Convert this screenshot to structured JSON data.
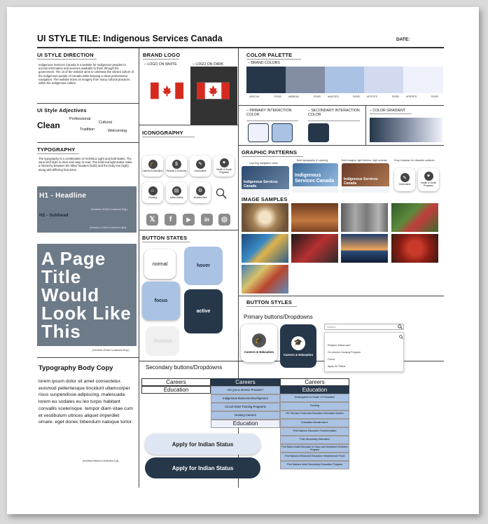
{
  "title": "UI STYLE TILE: Indigenous Services Canada",
  "date_label": "DATE:",
  "ui_style_direction": {
    "heading": "UI STYLE DIRECTION",
    "body": "Indigenous Services Canada is a website for Indigenous peoples to access information and services available to them through the government. The UI of the website aims to celebrate the vibrant culture of the Indigenous people of Canada while keeping a clean professional navigation. The website leans on imagery from many cultural practices within the Indigenous culture."
  },
  "adjectives": {
    "heading": "UI Style Adjectives",
    "clean": "Clean",
    "professional": "Professional",
    "cultural": "Cultural",
    "tradition": "Tradition",
    "welcoming": "Welcoming"
  },
  "typography": {
    "heading": "TYPOGRAPHY",
    "body": "The typography is a combination of Helvetica Light and bold states. The sans serif style is clear and easy to read. The bold and light states make a hierarchy between the titles/ headers (bold) and the body text (light), along with differing font sizes.",
    "h1": "H1 - Headline",
    "h1_note": "(Helvetica 18 Bold Condensed Regl.)",
    "h2": "H2 - Subhead",
    "h2_note": "(Helvetica 14 Bold Condensed Light)",
    "page_title": "A Page Title Would Look Like This",
    "page_title_note": "(Helvetica 40 Bold Condensed Regl.)",
    "body_heading": "Typography Body Copy",
    "body_copy": "lorem ipsum dolor sit amet consectetur. euismod pellentesque tincidunt ullamcorper risus suspendisse adipiscing. malesuada lorem eu sodales eu leo turpis habitant convallis scelerisque. tempor diam vitae cum et vestibulum ultrices aliquet imperdiet ornare. eget donec bibendum natoque tortor.",
    "body_note": "(Helvetica Medium Condensed  11pt)"
  },
  "brand_logo": {
    "heading": "BRAND LOGO",
    "on_white": "– LOGO ON WHITE",
    "on_dark": "– LOGO ON DARK"
  },
  "iconography": {
    "heading": "ICONOGRAPHY",
    "icons": [
      {
        "name": "careers-education",
        "label": "Careers & Education",
        "glyph": "🎓"
      },
      {
        "name": "finance-economy",
        "label": "Finance & Economy",
        "glyph": "$"
      },
      {
        "name": "governance",
        "label": "Governance",
        "glyph": "✎"
      },
      {
        "name": "health-social",
        "label": "Health & Social Programs",
        "glyph": "♥"
      },
      {
        "name": "housing",
        "label": "Housing",
        "glyph": "⌂"
      },
      {
        "name": "indian-status",
        "label": "Indian Status",
        "glyph": "▤"
      },
      {
        "name": "infrastructure",
        "label": "Infrastructure",
        "glyph": "⚙"
      }
    ],
    "social": [
      {
        "name": "x",
        "glyph": "𝕏"
      },
      {
        "name": "facebook",
        "glyph": "f"
      },
      {
        "name": "youtube",
        "glyph": "▶"
      },
      {
        "name": "linkedin",
        "glyph": "in"
      },
      {
        "name": "instagram",
        "glyph": "◎"
      }
    ]
  },
  "button_states": {
    "heading": "BUTTON STATES",
    "normal": "normal",
    "hover": "hover",
    "focus": "focus",
    "active": "active",
    "disabled": "disabled"
  },
  "color_palette": {
    "heading": "COLOR PALETTE",
    "brand_colors": "– BRAND COLORS",
    "swatches": [
      {
        "hex": "#26374A",
        "code": "#26374A",
        "rgb": "R/G/B"
      },
      {
        "hex": "#838DA3",
        "code": "#838DA3",
        "rgb": "R/G/B"
      },
      {
        "hex": "#AAC2E3",
        "code": "#AAC2E3",
        "rgb": "R/G/B"
      },
      {
        "hex": "#D2DAF0",
        "code": "#F2F2F5",
        "rgb": "R/G/B"
      },
      {
        "hex": "#F5F5FD",
        "code": "#F5F5FD",
        "rgb": "R/G/B"
      }
    ],
    "primary_interaction": "– PRIMARY INTERACTION COLOR",
    "secondary_interaction": "– SECONDARY INTERACTION COLOR",
    "gradient": "– COLOR GRADIENT",
    "primary_a": "#EEF1FB",
    "primary_b": "#AAC2E3",
    "secondary": "#26374A"
  },
  "graphic_patterns": {
    "heading": "GRAPHIC PATTERNS",
    "p1_caption": "Layering navigation cards",
    "p2_caption": "Bold typography & Layering",
    "p3_caption": "Bold imagery, light buttons, high contrast",
    "p4_caption": "Drop shadows for clickable surfaces",
    "site_name": "Indigenous Services Canada",
    "site_name2": "Indigenous Services Canada",
    "card1": "Governance",
    "card2": "Health & Social Programs"
  },
  "image_samples": {
    "heading": "IMAGE SAMPLES"
  },
  "button_styles": {
    "heading": "BUTTON STYLES",
    "primary_heading": "Primary buttons/Dropdowns",
    "btn_light": "Careers & Education",
    "btn_dark": "Careers & Education",
    "search_placeholder": "Search",
    "search_items": [
      "Replace Status card",
      "On-reserve Housing Program",
      "Forms",
      "Apply for Status"
    ]
  },
  "secondary": {
    "heading": "Secondary buttons/Dropdowns",
    "careers": "Careers",
    "education": "Education",
    "col1": [
      "Careers",
      "Education"
    ],
    "col2_head": "Careers",
    "col2": [
      "Are you a Service Provider?",
      "Indigenous Business Development",
      "Circuit Rider Training Programs",
      "Nursing Careers",
      "Education"
    ],
    "col3_head1": "Careers",
    "col3_head2": "Education",
    "col3": [
      "Kindergarten to Grade 12 Education",
      "Funding",
      "ISC Services Portal and Education Information System",
      "Education Infrastructure",
      "First Nations Education Transformation",
      "Post-Secondary Education",
      "First Nation Adult Education in Yukon and Northwest Territories Program",
      "First Nations Enhanced Education Infrastructure Fund",
      "First Nations Adult Secondary Education Program"
    ],
    "apply_light": "Apply for Indian Status",
    "apply_dark": "Apply for Indian Status"
  }
}
